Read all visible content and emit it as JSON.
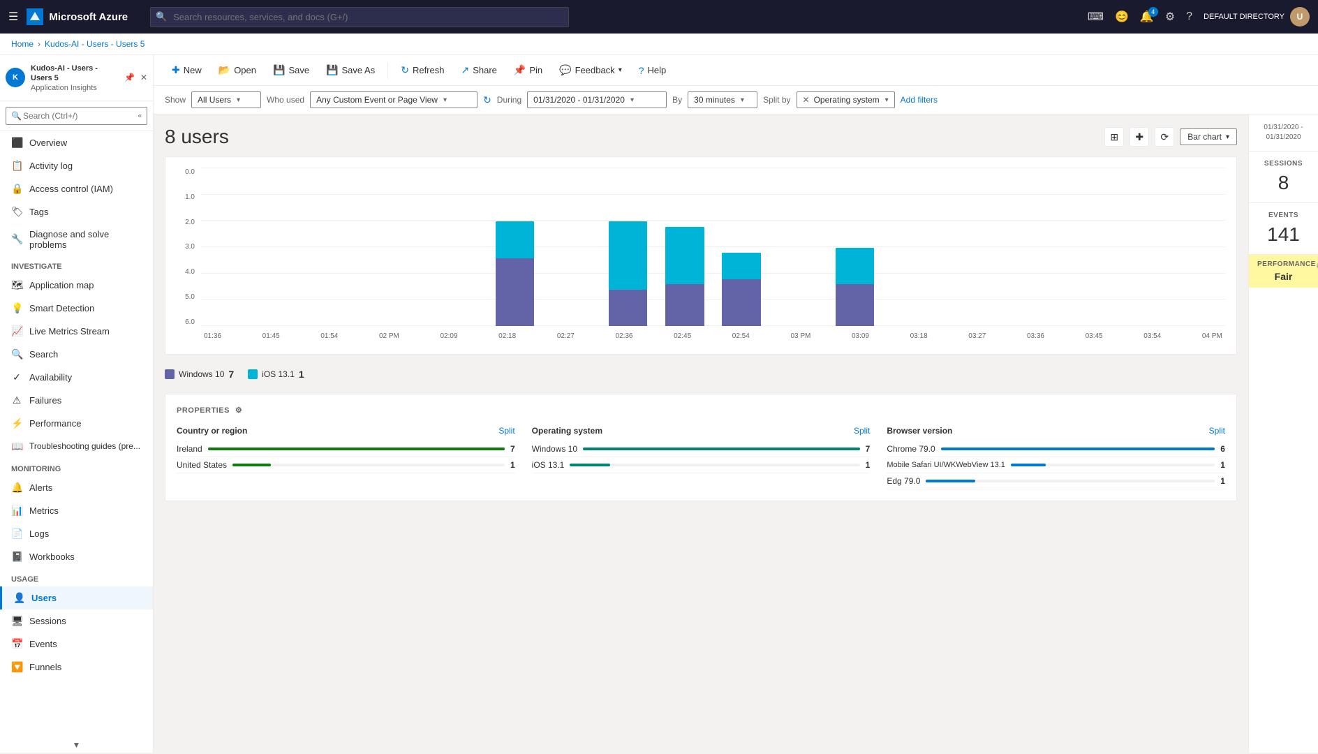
{
  "topbar": {
    "logo_text": "Microsoft Azure",
    "search_placeholder": "Search resources, services, and docs (G+/)",
    "notifications_count": "4",
    "user_label": "DEFAULT DIRECTORY",
    "user_initials": "U"
  },
  "breadcrumb": {
    "home": "Home",
    "parent": "Kudos-AI - Users - Users 5",
    "current": "Kudos-AI - Users - Users 5"
  },
  "sidebar_header": {
    "title": "Kudos-AI - Users - Users 5",
    "subtitle": "Application Insights",
    "initials": "K"
  },
  "sidebar_search": {
    "placeholder": "Search (Ctrl+/)"
  },
  "sidebar_nav": [
    {
      "id": "overview",
      "label": "Overview",
      "icon": "⬛",
      "section": ""
    },
    {
      "id": "activity-log",
      "label": "Activity log",
      "icon": "📋",
      "section": ""
    },
    {
      "id": "access-control",
      "label": "Access control (IAM)",
      "icon": "🔒",
      "section": ""
    },
    {
      "id": "tags",
      "label": "Tags",
      "icon": "🏷",
      "section": ""
    },
    {
      "id": "diagnose",
      "label": "Diagnose and solve problems",
      "icon": "🔧",
      "section": ""
    }
  ],
  "sidebar_investigate": {
    "section": "Investigate",
    "items": [
      {
        "id": "application-map",
        "label": "Application map",
        "icon": "🗺"
      },
      {
        "id": "smart-detection",
        "label": "Smart Detection",
        "icon": "💡"
      },
      {
        "id": "live-metrics",
        "label": "Live Metrics Stream",
        "icon": "📈"
      },
      {
        "id": "search",
        "label": "Search",
        "icon": "🔍"
      },
      {
        "id": "availability",
        "label": "Availability",
        "icon": "✓"
      },
      {
        "id": "failures",
        "label": "Failures",
        "icon": "⚠"
      },
      {
        "id": "performance",
        "label": "Performance",
        "icon": "⚡"
      },
      {
        "id": "troubleshooting",
        "label": "Troubleshooting guides (pre...",
        "icon": "📖"
      }
    ]
  },
  "sidebar_monitoring": {
    "section": "Monitoring",
    "items": [
      {
        "id": "alerts",
        "label": "Alerts",
        "icon": "🔔"
      },
      {
        "id": "metrics",
        "label": "Metrics",
        "icon": "📊"
      },
      {
        "id": "logs",
        "label": "Logs",
        "icon": "📄"
      },
      {
        "id": "workbooks",
        "label": "Workbooks",
        "icon": "📓"
      }
    ]
  },
  "sidebar_usage": {
    "section": "Usage",
    "items": [
      {
        "id": "users",
        "label": "Users",
        "icon": "👤",
        "active": true
      },
      {
        "id": "sessions",
        "label": "Sessions",
        "icon": "🖥"
      },
      {
        "id": "events",
        "label": "Events",
        "icon": "📅"
      },
      {
        "id": "funnels",
        "label": "Funnels",
        "icon": "🔽"
      }
    ]
  },
  "toolbar": {
    "new_label": "New",
    "open_label": "Open",
    "save_label": "Save",
    "save_as_label": "Save As",
    "refresh_label": "Refresh",
    "share_label": "Share",
    "pin_label": "Pin",
    "feedback_label": "Feedback",
    "help_label": "Help"
  },
  "filters": {
    "show_label": "Show",
    "show_value": "All Users",
    "who_used_label": "Who used",
    "who_used_value": "Any Custom Event or Page View",
    "during_label": "During",
    "during_value": "01/31/2020 - 01/31/2020",
    "by_label": "By",
    "by_value": "30 minutes",
    "split_by_label": "Split by",
    "split_by_value": "Operating system",
    "add_filters": "Add filters"
  },
  "chart": {
    "users_count": "8 users",
    "chart_type": "Bar chart",
    "date_range": "01/31/2020 -\n01/31/2020",
    "y_labels": [
      "0.0",
      "1.0",
      "2.0",
      "3.0",
      "4.0",
      "5.0",
      "6.0"
    ],
    "x_labels": [
      "01:36",
      "01:45",
      "01:54",
      "02 PM",
      "02:09",
      "02:18",
      "02:27",
      "02:36",
      "02:45",
      "02:54",
      "03 PM",
      "03:09",
      "03:18",
      "03:27",
      "03:36",
      "03:45",
      "03:54",
      "04 PM"
    ],
    "bars": [
      {
        "cyan": 0,
        "purple": 0
      },
      {
        "cyan": 0,
        "purple": 0
      },
      {
        "cyan": 0,
        "purple": 0
      },
      {
        "cyan": 0,
        "purple": 0
      },
      {
        "cyan": 0,
        "purple": 0
      },
      {
        "cyan": 35,
        "purple": 65
      },
      {
        "cyan": 0,
        "purple": 0
      },
      {
        "cyan": 65,
        "purple": 35
      },
      {
        "cyan": 55,
        "purple": 40
      },
      {
        "cyan": 25,
        "purple": 45
      },
      {
        "cyan": 0,
        "purple": 0
      },
      {
        "cyan": 35,
        "purple": 40
      },
      {
        "cyan": 0,
        "purple": 0
      },
      {
        "cyan": 0,
        "purple": 0
      },
      {
        "cyan": 0,
        "purple": 0
      },
      {
        "cyan": 0,
        "purple": 0
      },
      {
        "cyan": 0,
        "purple": 0
      },
      {
        "cyan": 0,
        "purple": 0
      }
    ],
    "legend": [
      {
        "os": "Windows 10",
        "color": "purple",
        "count": "7"
      },
      {
        "os": "iOS 13.1",
        "color": "cyan",
        "count": "1"
      }
    ]
  },
  "right_panel": {
    "sessions_label": "SESSIONS",
    "sessions_value": "8",
    "events_label": "EVENTS",
    "events_value": "141",
    "performance_label": "PERFORMANCE",
    "performance_value": "Fair",
    "date_text": "01/31/2020 -\n01/31/2020"
  },
  "properties": {
    "title": "PROPERTIES",
    "columns": [
      {
        "title": "Country or region",
        "split_label": "Split",
        "rows": [
          {
            "label": "Ireland",
            "value": 7,
            "max": 7,
            "bar_pct": 100
          },
          {
            "label": "United States",
            "value": 1,
            "max": 7,
            "bar_pct": 14
          }
        ]
      },
      {
        "title": "Operating system",
        "split_label": "Split",
        "rows": [
          {
            "label": "Windows 10",
            "value": 7,
            "max": 7,
            "bar_pct": 100
          },
          {
            "label": "iOS 13.1",
            "value": 1,
            "max": 7,
            "bar_pct": 14
          }
        ]
      },
      {
        "title": "Browser version",
        "split_label": "Split",
        "rows": [
          {
            "label": "Chrome 79.0",
            "value": 6,
            "max": 6,
            "bar_pct": 100
          },
          {
            "label": "Mobile Safari UI/WKWebView 13.1",
            "value": 1,
            "max": 6,
            "bar_pct": 17
          },
          {
            "label": "Edg 79.0",
            "value": 1,
            "max": 6,
            "bar_pct": 17
          }
        ]
      }
    ]
  }
}
